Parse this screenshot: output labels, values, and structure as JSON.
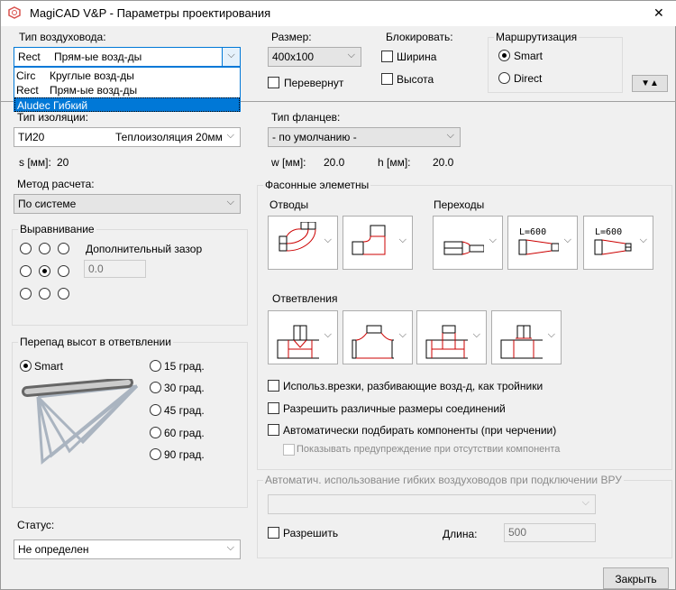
{
  "window": {
    "title": "MagiCAD V&P - Параметры проектирования",
    "close": "✕",
    "accent": "#0078d7"
  },
  "duct_type": {
    "label": "Тип воздуховода:",
    "code": "Rect",
    "value": "Прям-ые возд-ды",
    "options": [
      {
        "code": "Circ",
        "name": "Круглые возд-ды"
      },
      {
        "code": "Rect",
        "name": "Прям-ые возд-ды"
      },
      {
        "code": "Aludec",
        "name": "Гибкий",
        "selected": true
      }
    ]
  },
  "size": {
    "label": "Размер:",
    "value": "400x100"
  },
  "flip": {
    "label": "Перевернут",
    "checked": false
  },
  "lock": {
    "label": "Блокировать:",
    "width": "Ширина",
    "height": "Высота"
  },
  "routing": {
    "label": "Маршрутизация",
    "smart": "Smart",
    "direct": "Direct",
    "selected": "Smart"
  },
  "arrows_button": "▼▲",
  "insulation": {
    "label": "Тип изоляции:",
    "code": "ТИ20",
    "value": "Теплоизоляция 20мм",
    "s_label": "s [мм]:",
    "s_value": "20"
  },
  "flange": {
    "label": "Тип фланцев:",
    "value": "- по умолчанию -",
    "w_label": "w [мм]:",
    "w_value": "20.0",
    "h_label": "h [мм]:",
    "h_value": "20.0"
  },
  "calc": {
    "label": "Метод расчета:",
    "value": "По системе"
  },
  "align": {
    "label": "Выравнивание",
    "gap_label": "Дополнительный зазор",
    "gap_value": "0.0",
    "selected": "center"
  },
  "height_diff": {
    "label": "Перепад высот в ответвлении",
    "smart": "Smart",
    "options": [
      "15 град.",
      "30 град.",
      "45 град.",
      "60 град.",
      "90 град."
    ]
  },
  "status": {
    "label": "Статус:",
    "value": "Не определен"
  },
  "fittings": {
    "label": "Фасонные элеметны",
    "bends": "Отводы",
    "transitions": "Переходы",
    "branches": "Ответвления",
    "l_text": "L=600"
  },
  "options": [
    {
      "label": "Использ.врезки, разбивающие возд-д, как тройники",
      "checked": false
    },
    {
      "label": "Разрешить различные размеры соединений",
      "checked": false
    },
    {
      "label": "Автоматически подбирать компоненты (при черчении)",
      "checked": false
    },
    {
      "label": "Показывать предупреждение при отсутствии компонента",
      "checked": false,
      "disabled": true
    }
  ],
  "flex": {
    "label": "Автоматич. использование гибких воздуховодов при подключении ВРУ",
    "allow": "Разрешить",
    "length_label": "Длина:",
    "length_value": "500"
  },
  "close_button": "Закрыть"
}
